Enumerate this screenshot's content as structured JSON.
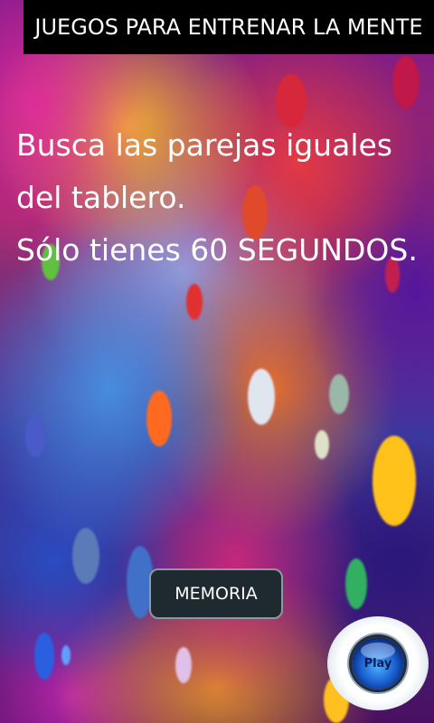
{
  "header": {
    "title": "JUEGOS PARA ENTRENAR LA MENTE"
  },
  "intro": {
    "lines": [
      "Busca las parejas iguales",
      "del tablero.",
      "Sólo tienes 60 SEGUNDOS."
    ]
  },
  "memoria_button": {
    "label": "MEMORIA"
  },
  "play_button": {
    "label": "Play",
    "icon": "play-orb-icon"
  },
  "colors": {
    "header_bg": "#000000",
    "text": "#ffffff",
    "button_bg": "#1e2a30",
    "button_border": "#8a9aa0",
    "play_orb": "#1a5fd0"
  }
}
